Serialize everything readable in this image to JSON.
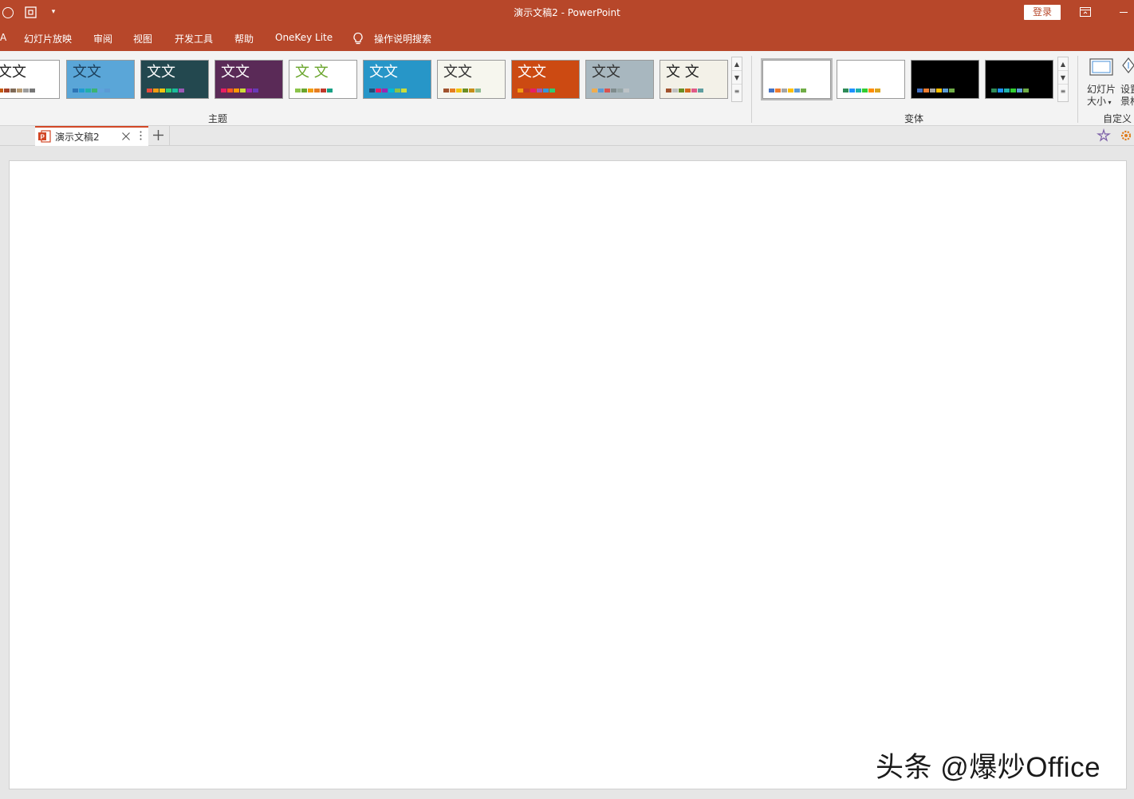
{
  "titlebar": {
    "title": "演示文稿2  -  PowerPoint",
    "login_label": "登录",
    "color": "#b7472a"
  },
  "tabs": {
    "partial_left": "A",
    "items": [
      "幻灯片放映",
      "审阅",
      "视图",
      "开发工具",
      "帮助",
      "OneKey Lite"
    ],
    "tell_me": "操作说明搜索"
  },
  "ribbon": {
    "themes": [
      {
        "text": "文文",
        "bg": "#ffffff",
        "fg": "#222222",
        "colors": [
          "#c55a11",
          "#a5432a",
          "#7f6a57",
          "#b89b73",
          "#9e9e9e",
          "#777777"
        ]
      },
      {
        "text": "文文",
        "bg": "#5aa6d8",
        "fg": "#1c3e5a",
        "colors": [
          "#2e75b6",
          "#1f9bd1",
          "#22b0a8",
          "#3cb371",
          "#5fa2dd",
          "#5b9bd5"
        ]
      },
      {
        "text": "文文",
        "bg": "#23484f",
        "fg": "#ffffff",
        "colors": [
          "#e84c3d",
          "#f39c12",
          "#f1c40f",
          "#2ecc71",
          "#1abc9c",
          "#9b59b6"
        ]
      },
      {
        "text": "文文",
        "bg": "#5a2a57",
        "fg": "#ffffff",
        "colors": [
          "#e91e63",
          "#ff5722",
          "#ff9800",
          "#cddc39",
          "#9c27b0",
          "#673ab7"
        ]
      },
      {
        "text": "文 文",
        "bg": "#ffffff",
        "fg": "#6aa52c",
        "colors": [
          "#8bc34a",
          "#6aa52c",
          "#f39c12",
          "#e67e22",
          "#c0392b",
          "#16a085"
        ]
      },
      {
        "text": "文文",
        "bg": "#2796c8",
        "fg": "#ffffff",
        "colors": [
          "#1e4e79",
          "#e91e63",
          "#9c27b0",
          "#00bcd4",
          "#8bc34a",
          "#cddc39"
        ]
      },
      {
        "text": "文文",
        "bg": "#f6f6ee",
        "fg": "#333333",
        "colors": [
          "#a0522d",
          "#e67e22",
          "#f1c40f",
          "#6b8e23",
          "#c68e17",
          "#8fbc8f"
        ]
      },
      {
        "text": "文文",
        "bg": "#cc4a12",
        "fg": "#ffffff",
        "colors": [
          "#f39c12",
          "#c0392b",
          "#e91e63",
          "#9b59b6",
          "#3498db",
          "#2ecc71"
        ]
      },
      {
        "text": "文文",
        "bg": "#a8b7bf",
        "fg": "#333333",
        "colors": [
          "#f0ad4e",
          "#5b9bd5",
          "#d9534f",
          "#7f8c8d",
          "#95a5a6",
          "#bdc3c7"
        ]
      },
      {
        "text": "文 文",
        "bg": "#f3f1e8",
        "fg": "#222222",
        "colors": [
          "#a0522d",
          "#c0c0c0",
          "#6b8e23",
          "#d2691e",
          "#e05a87",
          "#5f9ea0"
        ]
      }
    ],
    "themes_group_label": "主题",
    "variants": [
      {
        "bg": "#ffffff",
        "colors": [
          "#4472c4",
          "#ed7d31",
          "#a5a5a5",
          "#ffc000",
          "#5b9bd5",
          "#70ad47"
        ]
      },
      {
        "bg": "#ffffff",
        "colors": [
          "#2e8b57",
          "#1e90ff",
          "#20b2aa",
          "#32cd32",
          "#ff8c00",
          "#daa520"
        ]
      },
      {
        "bg": "#000000",
        "colors": [
          "#4472c4",
          "#ed7d31",
          "#a5a5a5",
          "#ffc000",
          "#5b9bd5",
          "#70ad47"
        ]
      },
      {
        "bg": "#000000",
        "colors": [
          "#2e8b57",
          "#1e90ff",
          "#20b2aa",
          "#32cd32",
          "#5b9bd5",
          "#70ad47"
        ]
      }
    ],
    "variants_group_label": "变体",
    "slide_size_line1": "幻灯片",
    "slide_size_line2": "大小",
    "format_bg_line1": "设置",
    "format_bg_line2": "景格",
    "customize_group_label": "自定义"
  },
  "doc": {
    "tab_label": "演示文稿2"
  },
  "watermark": "头条 @爆炒Office"
}
